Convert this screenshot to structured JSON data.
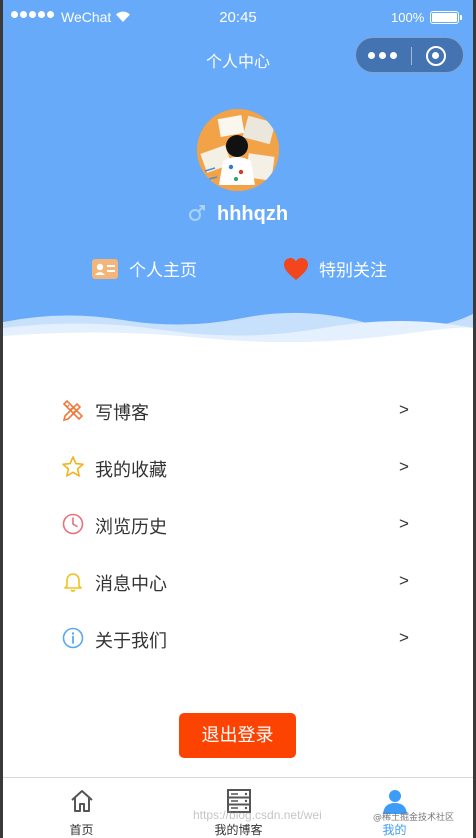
{
  "status_bar": {
    "carrier": "WeChat",
    "time": "20:45",
    "battery": "100%"
  },
  "nav": {
    "title": "个人中心"
  },
  "profile": {
    "username": "hhhqzh",
    "gender_icon": "male-icon"
  },
  "quick_links": [
    {
      "label": "个人主页",
      "icon": "profile-card-icon"
    },
    {
      "label": "特别关注",
      "icon": "heart-icon"
    }
  ],
  "menu": [
    {
      "label": "写博客",
      "icon": "pencil-ruler-icon",
      "arrow": ">"
    },
    {
      "label": "我的收藏",
      "icon": "star-icon",
      "arrow": ">"
    },
    {
      "label": "浏览历史",
      "icon": "clock-icon",
      "arrow": ">"
    },
    {
      "label": "消息中心",
      "icon": "bell-icon",
      "arrow": ">"
    },
    {
      "label": "关于我们",
      "icon": "info-icon",
      "arrow": ">"
    }
  ],
  "logout_label": "退出登录",
  "tabs": [
    {
      "label": "首页",
      "icon": "home-icon"
    },
    {
      "label": "我的博客",
      "icon": "server-icon"
    },
    {
      "label": "我的",
      "icon": "user-icon",
      "active": true
    }
  ],
  "watermark": {
    "url": "https://blog.csdn.net/wei",
    "badge": "@稀土掘金技术社区"
  },
  "colors": {
    "header_bg": "#66aaf9",
    "logout_bg": "#fd4301",
    "active_tab": "#3c9cf7"
  }
}
